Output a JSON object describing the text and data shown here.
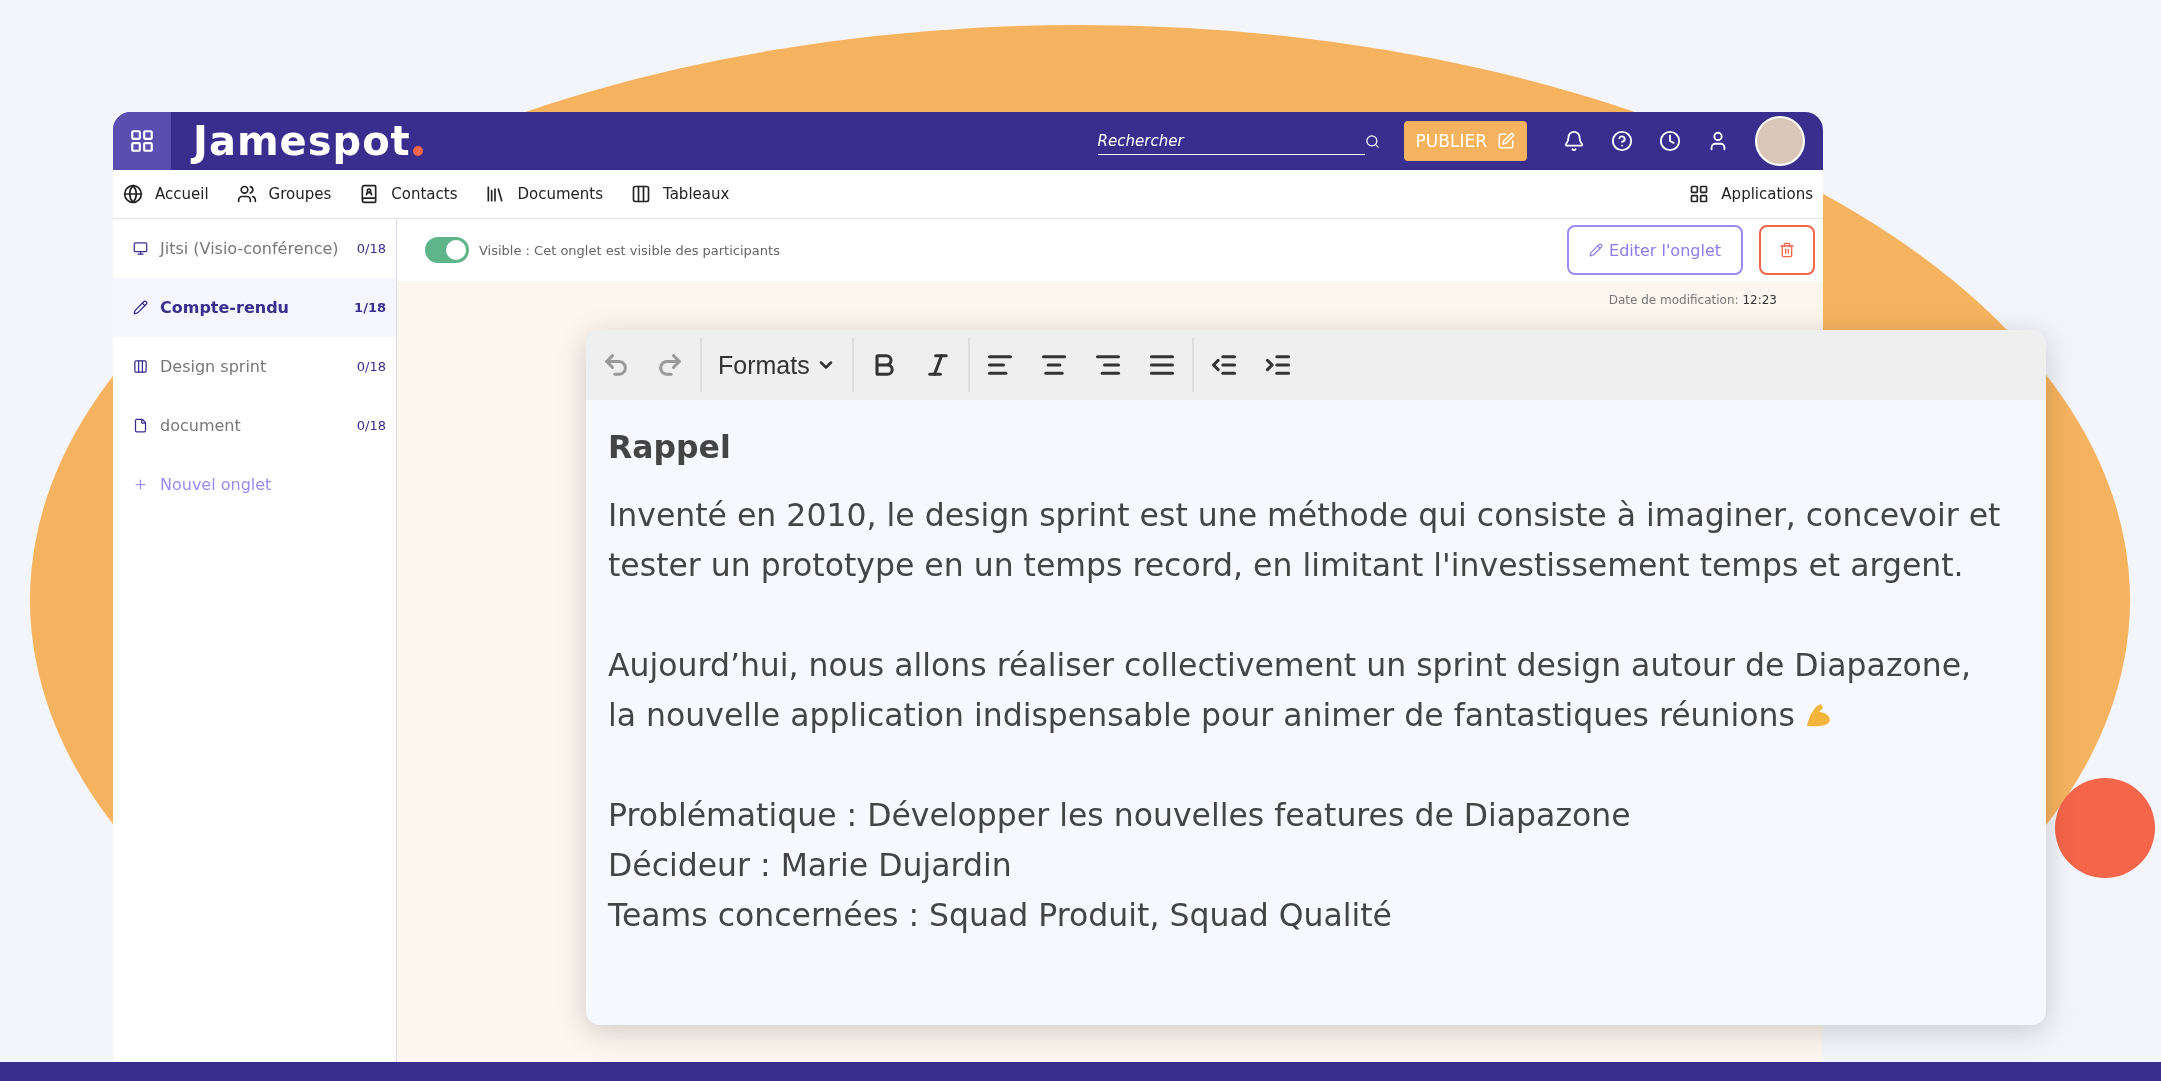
{
  "topbar": {
    "logo": "Jamespot",
    "search": {
      "placeholder": "Rechercher"
    },
    "publish": "PUBLIER"
  },
  "nav": {
    "items": [
      {
        "kind": "globe",
        "label": "Accueil"
      },
      {
        "kind": "users",
        "label": "Groupes"
      },
      {
        "kind": "contacts",
        "label": "Contacts"
      },
      {
        "kind": "library",
        "label": "Documents"
      },
      {
        "kind": "board",
        "label": "Tableaux"
      }
    ],
    "apps": "Applications"
  },
  "sidebar": {
    "items": [
      {
        "kind": "screen",
        "label": "Jitsi (Visio-conférence)",
        "count": "0/18",
        "selected": false
      },
      {
        "kind": "pencil",
        "label": "Compte-rendu",
        "count": "1/18",
        "selected": true
      },
      {
        "kind": "board",
        "label": "Design sprint",
        "count": "0/18",
        "selected": false
      },
      {
        "kind": "document",
        "label": "document",
        "count": "0/18",
        "selected": false
      }
    ],
    "new_tab": "Nouvel onglet"
  },
  "tab_bar": {
    "visible": {
      "on": true,
      "label": "Visible : Cet onglet est visible des participants"
    },
    "edit": "Editer l'onglet",
    "date_label": "Date de modification:",
    "date_value": "12:23"
  },
  "editor": {
    "toolbar": [
      [
        {
          "kind": "undo",
          "disabled": true
        },
        {
          "kind": "redo",
          "disabled": true
        }
      ],
      [
        {
          "kind": "formats",
          "label": "Formats",
          "disabled": false
        }
      ],
      [
        {
          "kind": "bold",
          "disabled": false
        },
        {
          "kind": "italic",
          "disabled": false
        }
      ],
      [
        {
          "kind": "align-left",
          "disabled": false
        },
        {
          "kind": "align-center",
          "disabled": false
        },
        {
          "kind": "align-right",
          "disabled": false
        },
        {
          "kind": "justify",
          "disabled": false
        }
      ],
      [
        {
          "kind": "outdent",
          "disabled": false
        },
        {
          "kind": "indent",
          "disabled": false
        }
      ]
    ],
    "heading": "Rappel",
    "paragraphs": [
      {
        "lines": [
          "Inventé en 2010, le design sprint est une méthode qui consiste à imaginer, concevoir et tester un prototype en un temps record, en limitant l'investissement temps et argent."
        ],
        "emoji": false
      },
      {
        "lines": [
          "Aujourd’hui, nous allons réaliser collectivement un sprint design autour de Diapazone, la nouvelle application indispensable pour animer de fantastiques réunions"
        ],
        "emoji": true
      },
      {
        "lines": [
          "Problématique : Développer les nouvelles features de Diapazone",
          "Décideur : Marie Dujardin",
          "Teams concernées : Squad Produit, Squad Qualité"
        ],
        "emoji": false
      }
    ]
  }
}
